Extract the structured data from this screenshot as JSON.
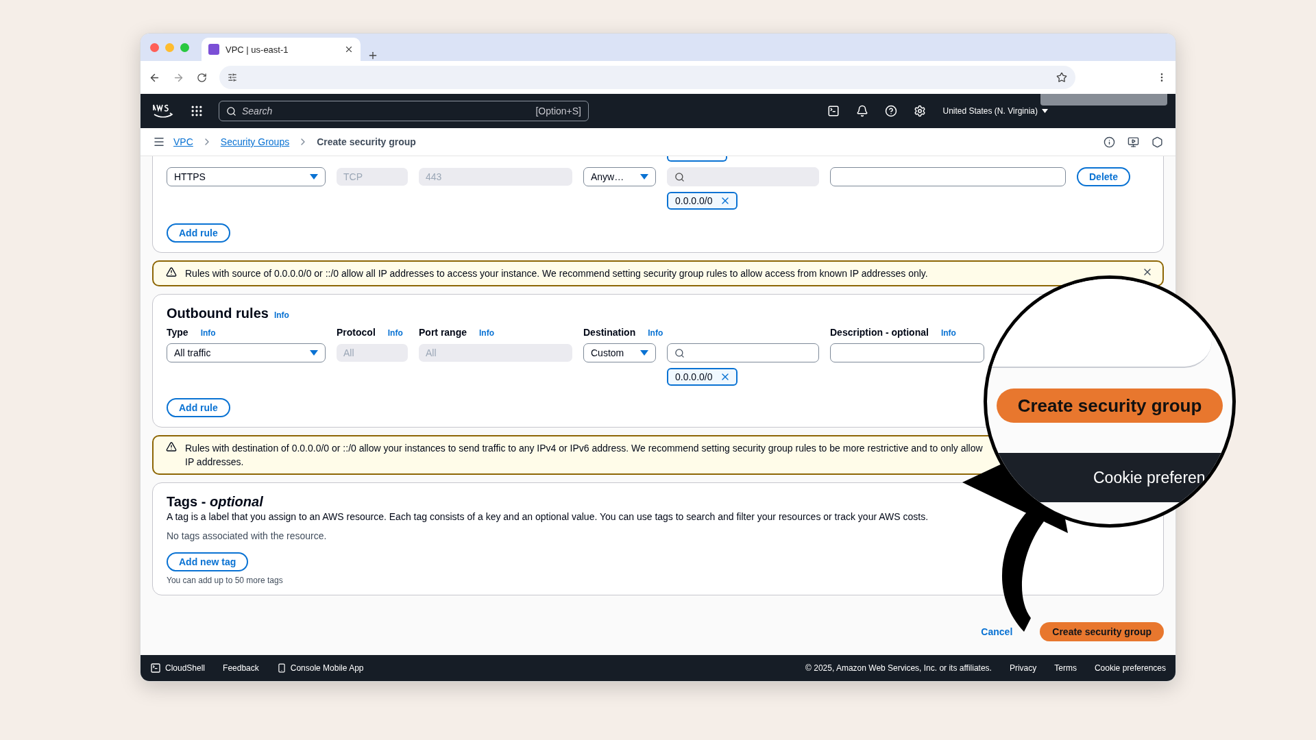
{
  "browser": {
    "tab_title": "VPC | us-east-1"
  },
  "console_nav": {
    "search_placeholder": "Search",
    "shortcut": "[Option+S]",
    "region": "United States (N. Virginia)"
  },
  "breadcrumbs": [
    {
      "label": "VPC",
      "link": true
    },
    {
      "label": "Security Groups",
      "link": true
    },
    {
      "label": "Create security group",
      "link": false
    }
  ],
  "inbound_rules": {
    "rows": [
      {
        "type": "HTTPS",
        "protocol": "TCP",
        "port_range": "443",
        "source": "Anyw…",
        "chips": [
          "0.0.0.0/0"
        ],
        "delete": "Delete"
      }
    ],
    "add_rule": "Add rule"
  },
  "inbound_warning": {
    "text": "Rules with source of 0.0.0.0/0 or ::/0 allow all IP addresses to access your instance. We recommend setting security group rules to allow access from known IP addresses only."
  },
  "outbound_rules": {
    "title": "Outbound rules",
    "title_info": "Info",
    "columns": [
      {
        "label": "Type",
        "info": "Info"
      },
      {
        "label": "Protocol",
        "info": "Info"
      },
      {
        "label": "Port range",
        "info": "Info"
      },
      {
        "label": "Destination",
        "info": "Info"
      },
      {
        "label": "Description - optional",
        "info": "Info"
      }
    ],
    "rows": [
      {
        "type": "All traffic",
        "protocol": "All",
        "port_range": "All",
        "destination": "Custom",
        "chips": [
          "0.0.0.0/0"
        ]
      }
    ],
    "add_rule": "Add rule"
  },
  "outbound_warning": {
    "lines": [
      "Rules with destination of 0.0.0.0/0 or ::/0 allow your instances to send traffic to any IPv4 or IPv6 address. We recommend setting security group rules to be more restrictive and to only allow",
      "IP addresses."
    ]
  },
  "tags": {
    "title": "Tags - *optional*",
    "description": "A tag is a label that you assign to an AWS resource. Each tag consists of a key and an optional value. You can use tags to search and filter your resources or track your AWS costs.",
    "empty": "No tags associated with the resource.",
    "add_button": "Add new tag",
    "hint": "You can add up to 50 more tags"
  },
  "actions": {
    "cancel": "Cancel",
    "submit": "Create security group"
  },
  "footer": {
    "cloudshell": "CloudShell",
    "feedback": "Feedback",
    "mobile_app": "Console Mobile App",
    "copyright": "© 2025, Amazon Web Services, Inc. or its affiliates.",
    "links": [
      "Privacy",
      "Terms",
      "Cookie preferences"
    ]
  },
  "magnifier": {
    "button": "Create security group",
    "footer_text": "Cookie preferen"
  }
}
